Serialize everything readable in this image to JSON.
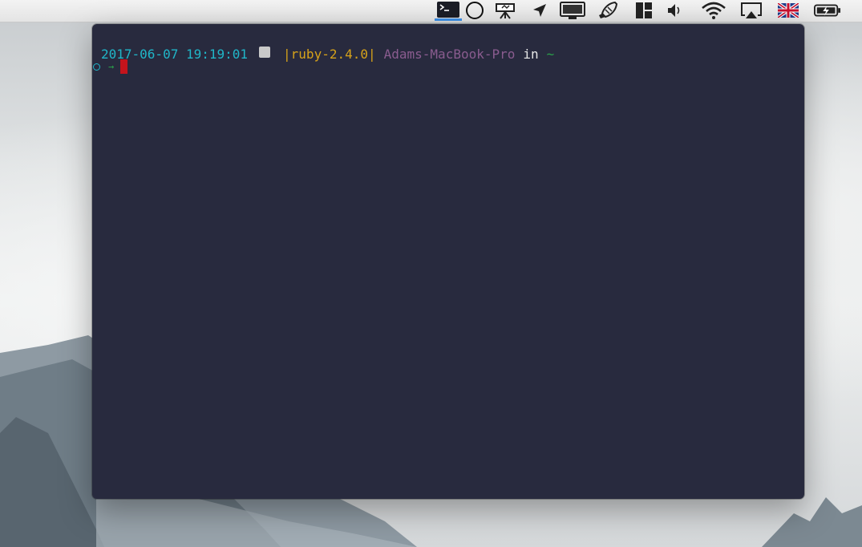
{
  "menubar": {
    "icons": [
      {
        "name": "terminal-icon",
        "active": true
      },
      {
        "name": "circle-icon"
      },
      {
        "name": "presentation-icon"
      },
      {
        "name": "location-arrow-icon"
      },
      {
        "name": "display-icon"
      },
      {
        "name": "rocket-icon"
      },
      {
        "name": "window-layout-icon"
      },
      {
        "name": "volume-icon"
      },
      {
        "name": "wifi-icon"
      },
      {
        "name": "airplay-icon"
      },
      {
        "name": "uk-flag-icon"
      },
      {
        "name": "battery-charging-icon"
      }
    ],
    "accent": "#3b8ee6"
  },
  "terminal": {
    "background": "#282a3e",
    "prompt": {
      "datetime": "2017-06-07 19:19:01",
      "ruby": "|ruby-2.4.0|",
      "host": "Adams-MacBook-Pro",
      "in": "in",
      "dir": "~",
      "arrow": "→"
    },
    "colors": {
      "datetime": "#20b6c8",
      "ruby": "#d6a21a",
      "host": "#8a5c8f",
      "dir": "#2aa24a",
      "cursor": "#c4141c"
    }
  }
}
